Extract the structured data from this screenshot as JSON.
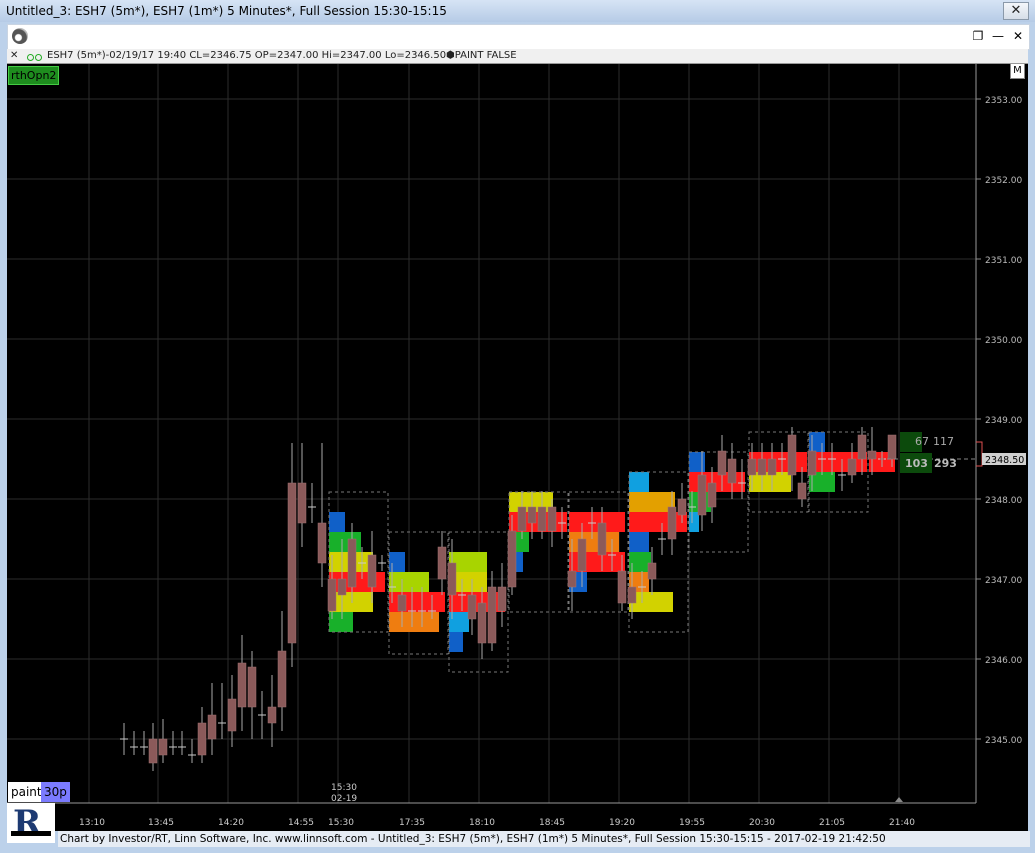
{
  "window": {
    "title": "Untitled_3: ESH7 (5m*), ESH7 (1m*) 5 Minutes*, Full Session 15:30-15:15",
    "close_label": "✕",
    "restore_label": "❐",
    "minimize_label": "—",
    "close2_label": "✕"
  },
  "infobar": {
    "close_label": "✕",
    "text": "ESH7 (5m*)-02/19/17 19:40 CL=2346.75 OP=2347.00 Hi=2347.00 Lo=2346.50",
    "paint_text": "⬢PAINT FALSE"
  },
  "chart": {
    "indicator_label": "rthOpn2",
    "m_label": "M",
    "paint_label": "paint",
    "period_label": "30p",
    "session_label": "15:30",
    "session_date": "02-19",
    "price_labels": [
      "2353.00",
      "2352.00",
      "2351.00",
      "2350.00",
      "2349.00",
      "2348.00",
      "2347.00",
      "2346.00",
      "2345.00"
    ],
    "time_labels": [
      "13:10",
      "13:45",
      "14:20",
      "14:55",
      "15:30",
      "17:35",
      "18:10",
      "18:45",
      "19:20",
      "19:55",
      "20:30",
      "21:05",
      "21:40"
    ],
    "last_price": "2348.50",
    "ask_value": "67",
    "ask_total": "117",
    "bid_value": "103",
    "bid_total": "293",
    "colors": {
      "background": "#000000",
      "grid": "#2c2c2c",
      "candle_body": "#8b5a5a",
      "candle_wick": "#aaaaaa",
      "profile_red": "#ff1a1a",
      "profile_orange": "#ef7d10",
      "profile_amber": "#e3a000",
      "profile_yellow": "#d2d200",
      "profile_lime": "#a8d400",
      "profile_green": "#18b02a",
      "profile_blue": "#1060c8",
      "profile_cyan": "#10a0e0"
    }
  },
  "footer": {
    "text": "Chart by Investor/RT, Linn Software, Inc. www.linnsoft.com - Untitled_3: ESH7 (5m*), ESH7 (1m*) 5 Minutes*, Full Session 15:30-15:15 - 2017-02-19 21:42:50"
  }
}
